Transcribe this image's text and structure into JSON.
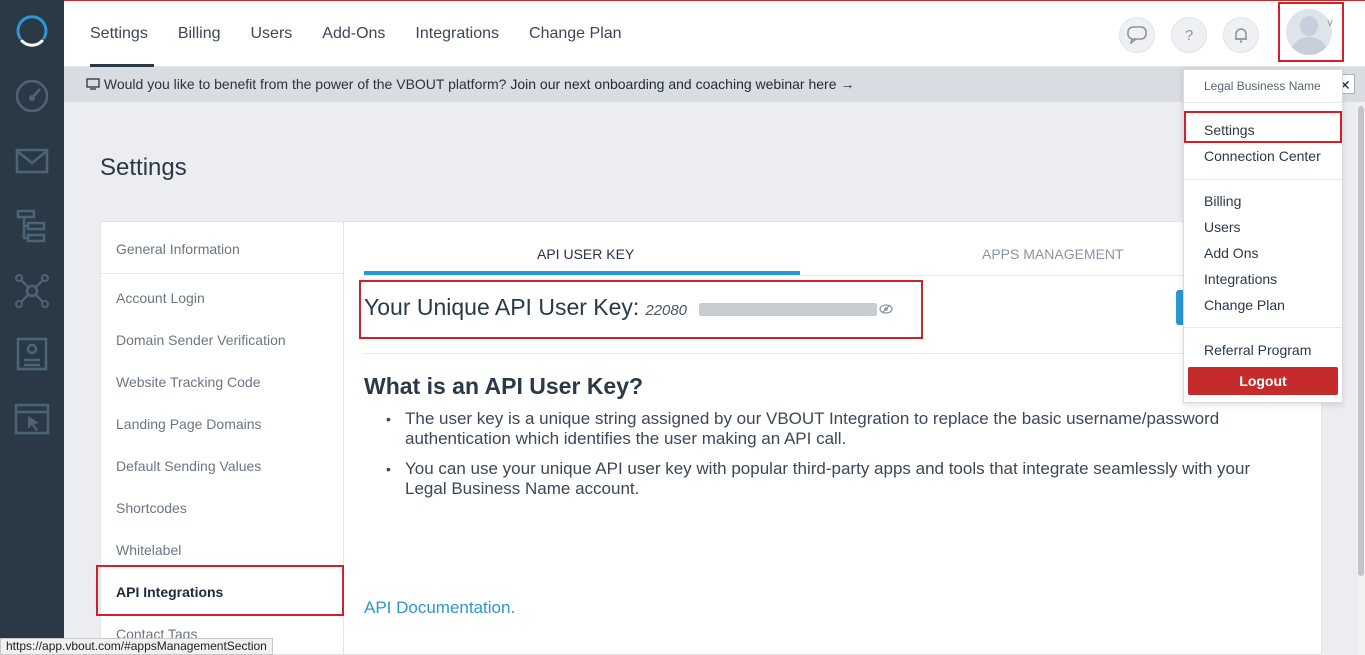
{
  "topnav": {
    "tabs": [
      "Settings",
      "Billing",
      "Users",
      "Add-Ons",
      "Integrations",
      "Change Plan"
    ],
    "active_tab": "Settings"
  },
  "banner": {
    "text": "Would you like to benefit from the power of the VBOUT platform?",
    "link_text": "Join our next onboarding and coaching webinar here →",
    "close_label": "✕"
  },
  "page_title": "Settings",
  "settings_menu": {
    "general": "General Information",
    "items": [
      "Account Login",
      "Domain Sender Verification",
      "Website Tracking Code",
      "Landing Page Domains",
      "Default Sending Values",
      "Shortcodes",
      "Whitelabel",
      "API Integrations",
      "Contact Tags"
    ],
    "active_item": "API Integrations"
  },
  "content": {
    "tabs": [
      "API USER KEY",
      "APPS MANAGEMENT"
    ],
    "key_label": "Your Unique API User Key:",
    "key_value_visible": "22080",
    "what_heading": "What is an API User Key?",
    "bullets": [
      "The user key is a unique string assigned by our VBOUT Integration to replace the basic username/password authentication which identifies the user making an API call.",
      "You can use your unique API user key with popular third-party apps and tools that integrate seamlessly with your Legal Business Name account."
    ],
    "api_doc_link": "API Documentation."
  },
  "dropdown": {
    "account_name": "Legal Business Name",
    "group1": [
      "Settings",
      "Connection Center"
    ],
    "group2": [
      "Billing",
      "Users",
      "Add Ons",
      "Integrations",
      "Change Plan"
    ],
    "group3": [
      "Referral Program"
    ],
    "logout": "Logout"
  },
  "status_url": "https://app.vbout.com/#appsManagementSection",
  "colors": {
    "rail_bg": "#2b3947",
    "accent_blue": "#2b97d6",
    "logout_red": "#c62b2b",
    "highlight_red": "#d41f26"
  }
}
